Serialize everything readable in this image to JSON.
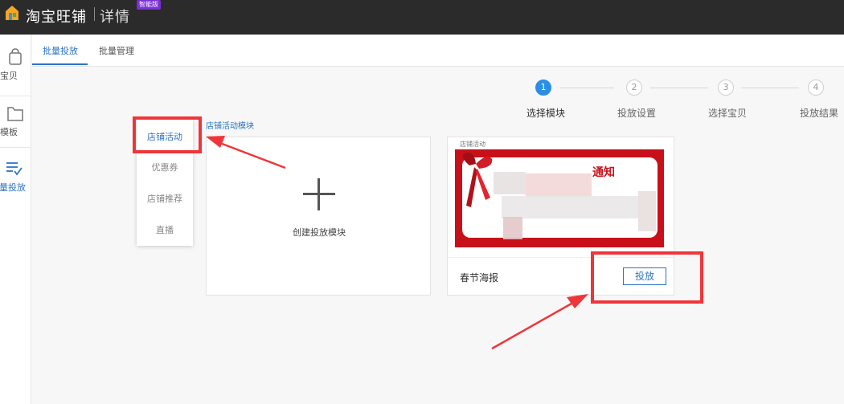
{
  "header": {
    "brand": "淘宝旺铺",
    "subtitle": "详情",
    "badge": "智能版"
  },
  "sidebar": {
    "items": [
      {
        "label": "宝贝",
        "icon": "bag-icon"
      },
      {
        "label": "模板",
        "icon": "folder-icon"
      },
      {
        "label": "批量投放",
        "icon": "list-check-icon",
        "active": true
      }
    ]
  },
  "tabs": [
    {
      "label": "批量投放",
      "active": true
    },
    {
      "label": "批量管理",
      "active": false
    }
  ],
  "steps": [
    {
      "number": "1",
      "label": "选择模块",
      "active": true
    },
    {
      "number": "2",
      "label": "投放设置",
      "active": false
    },
    {
      "number": "3",
      "label": "选择宝贝",
      "active": false
    },
    {
      "number": "4",
      "label": "投放结果",
      "active": false
    }
  ],
  "module": {
    "section_title": "店铺活动模块",
    "menu": [
      {
        "label": "店铺活动",
        "active": true
      },
      {
        "label": "优惠券",
        "active": false
      },
      {
        "label": "店铺推荐",
        "active": false
      },
      {
        "label": "直播",
        "active": false
      }
    ],
    "create_label": "创建投放模块",
    "poster": {
      "tag": "店铺活动",
      "title_fragment": "通知",
      "name": "春节海报",
      "button_label": "投放"
    }
  },
  "colors": {
    "accent": "#2b74c9",
    "highlight": "#f0353a",
    "poster_red": "#c8101a",
    "header_bg": "#2b2b2b"
  }
}
